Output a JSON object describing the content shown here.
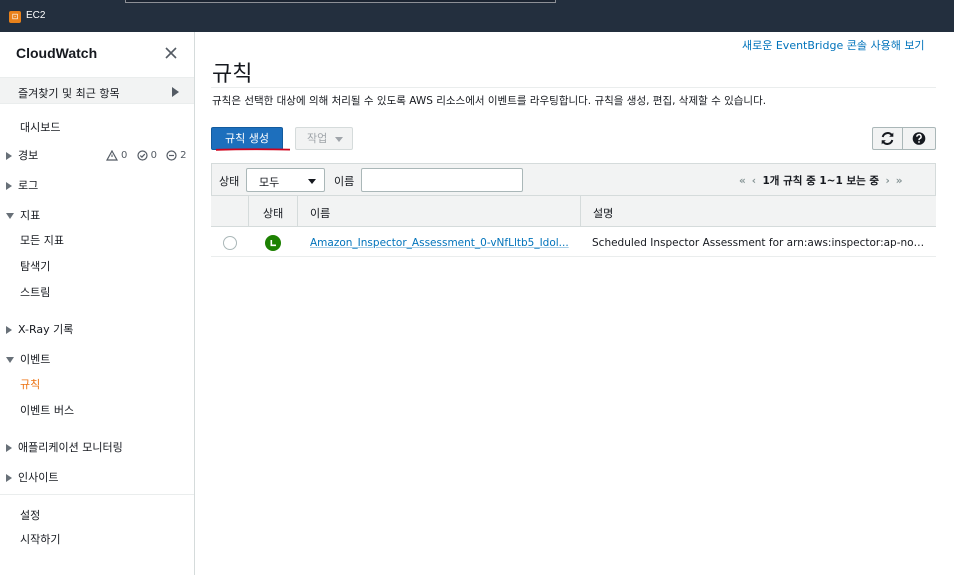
{
  "topbar": {
    "service_label": "EC2"
  },
  "sidebar": {
    "brand": "CloudWatch",
    "favorites": "즐겨찾기 및 최근 항목",
    "dashboard": "대시보드",
    "alarms": {
      "label": "경보",
      "counts": [
        "0",
        "0",
        "2"
      ]
    },
    "logs": "로그",
    "metrics": "지표",
    "all_metrics": "모든 지표",
    "explorer": "탐색기",
    "streams": "스트림",
    "xray": "X-Ray 기록",
    "events": "이벤트",
    "rules": "규칙",
    "event_buses": "이벤트 버스",
    "app_monitoring": "애플리케이션 모니터링",
    "insights": "인사이트",
    "settings": "설정",
    "getting_started": "시작하기"
  },
  "main": {
    "eventbridge_link": "새로운 EventBridge 콘솔 사용해 보기",
    "title": "규칙",
    "description": "규칙은 선택한 대상에 의해 처리될 수 있도록 AWS 리소스에서 이벤트를 라우팅합니다. 규칙을 생성, 편집, 삭제할 수 있습니다.",
    "create_button": "규칙 생성",
    "actions_button": "작업",
    "filter": {
      "status_label": "상태",
      "status_value": "모두",
      "name_label": "이름",
      "name_value": ""
    },
    "pager_text": "1개 규칙 중 1~1 보는 중",
    "table": {
      "headers": [
        "상태",
        "이름",
        "설명"
      ],
      "rows": [
        {
          "name": "Amazon_Inspector_Assessment_0-vNfLltb5_Idol...",
          "description": "Scheduled Inspector Assessment for arn:aws:inspector:ap-north..."
        }
      ]
    }
  },
  "colors": {
    "accent": "#ec7211",
    "primary_button": "#1d6fbd",
    "link": "#0073bb",
    "status_ok": "#1d8102"
  }
}
